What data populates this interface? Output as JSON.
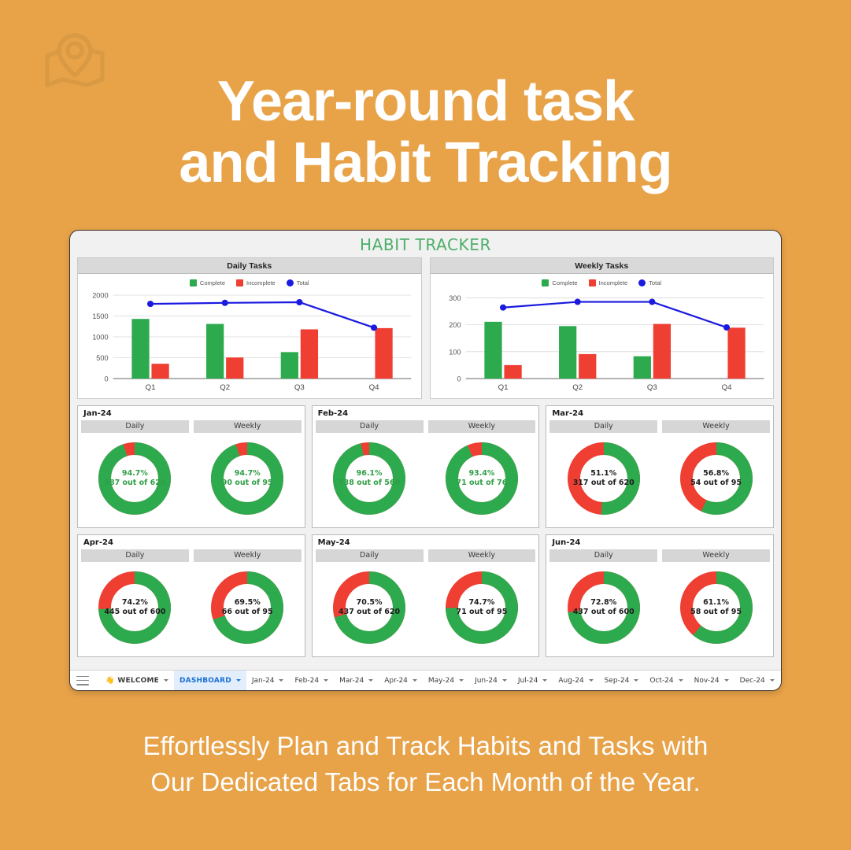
{
  "brand": {
    "logo_icon": "map-pin-icon",
    "bg_color": "#e8a349"
  },
  "headline": {
    "line1": "Year-round task",
    "line2": "and Habit Tracking"
  },
  "subtitle": {
    "line1": "Effortlessly Plan and Track Habits and Tasks with",
    "line2": "Our Dedicated Tabs for Each Month of the Year."
  },
  "window": {
    "title": "HABIT TRACKER",
    "title_color": "#4caf68"
  },
  "colors": {
    "complete_green": "#2eaa4e",
    "incomplete_red": "#ef3e32",
    "total_blue": "#1a1ae0",
    "header_gray": "#d9d9d9"
  },
  "legend": [
    {
      "label": "Complete",
      "swatch": "#2eaa4e",
      "shape": "square"
    },
    {
      "label": "Incomplete",
      "swatch": "#ef3e32",
      "shape": "square"
    },
    {
      "label": "Total",
      "swatch": "#1a1ae0",
      "shape": "dot"
    }
  ],
  "chart_data": [
    {
      "type": "bar",
      "title": "Daily Tasks",
      "categories": [
        "Q1",
        "Q2",
        "Q3",
        "Q4"
      ],
      "series": [
        {
          "name": "Complete",
          "type": "bar",
          "color": "#2eaa4e",
          "values": [
            1430,
            1310,
            635,
            0
          ]
        },
        {
          "name": "Incomplete",
          "type": "bar",
          "color": "#ef3e32",
          "values": [
            355,
            505,
            1180,
            1210
          ]
        },
        {
          "name": "Total",
          "type": "line",
          "color": "#1a1ae0",
          "values": [
            1790,
            1815,
            1830,
            1220
          ]
        }
      ],
      "xlabel": "",
      "ylabel": "",
      "ylim": [
        0,
        2000
      ],
      "yticks": [
        0,
        500,
        1000,
        1500,
        2000
      ],
      "grid": true,
      "legend_position": "top"
    },
    {
      "type": "bar",
      "title": "Weekly Tasks",
      "categories": [
        "Q1",
        "Q2",
        "Q3",
        "Q4"
      ],
      "series": [
        {
          "name": "Complete",
          "type": "bar",
          "color": "#2eaa4e",
          "values": [
            211,
            195,
            83,
            0
          ]
        },
        {
          "name": "Incomplete",
          "type": "bar",
          "color": "#ef3e32",
          "values": [
            50,
            91,
            203,
            189
          ]
        },
        {
          "name": "Total",
          "type": "line",
          "color": "#1a1ae0",
          "values": [
            264,
            285,
            285,
            190
          ]
        }
      ],
      "xlabel": "",
      "ylabel": "",
      "ylim": [
        0,
        310
      ],
      "yticks": [
        0,
        100,
        200,
        300
      ],
      "grid": true,
      "legend_position": "top"
    }
  ],
  "months": [
    {
      "label": "Jan-24",
      "panels": [
        {
          "head": "Daily",
          "percent": "94.7%",
          "count": "587 out of 620",
          "pct_value": 94.7,
          "text_color": "green"
        },
        {
          "head": "Weekly",
          "percent": "94.7%",
          "count": "90 out of 95",
          "pct_value": 94.7,
          "text_color": "green"
        }
      ]
    },
    {
      "label": "Feb-24",
      "panels": [
        {
          "head": "Daily",
          "percent": "96.1%",
          "count": "538 out of 560",
          "pct_value": 96.1,
          "text_color": "green"
        },
        {
          "head": "Weekly",
          "percent": "93.4%",
          "count": "71 out of 76",
          "pct_value": 93.4,
          "text_color": "green"
        }
      ]
    },
    {
      "label": "Mar-24",
      "panels": [
        {
          "head": "Daily",
          "percent": "51.1%",
          "count": "317 out of 620",
          "pct_value": 51.1,
          "text_color": "dark"
        },
        {
          "head": "Weekly",
          "percent": "56.8%",
          "count": "54 out of 95",
          "pct_value": 56.8,
          "text_color": "dark"
        }
      ]
    },
    {
      "label": "Apr-24",
      "panels": [
        {
          "head": "Daily",
          "percent": "74.2%",
          "count": "445 out of 600",
          "pct_value": 74.2,
          "text_color": "dark"
        },
        {
          "head": "Weekly",
          "percent": "69.5%",
          "count": "66 out of 95",
          "pct_value": 69.5,
          "text_color": "dark"
        }
      ]
    },
    {
      "label": "May-24",
      "panels": [
        {
          "head": "Daily",
          "percent": "70.5%",
          "count": "437 out of 620",
          "pct_value": 70.5,
          "text_color": "dark"
        },
        {
          "head": "Weekly",
          "percent": "74.7%",
          "count": "71 out of 95",
          "pct_value": 74.7,
          "text_color": "dark"
        }
      ]
    },
    {
      "label": "Jun-24",
      "panels": [
        {
          "head": "Daily",
          "percent": "72.8%",
          "count": "437 out of 600",
          "pct_value": 72.8,
          "text_color": "dark"
        },
        {
          "head": "Weekly",
          "percent": "61.1%",
          "count": "58 out of 95",
          "pct_value": 61.1,
          "text_color": "dark"
        }
      ]
    }
  ],
  "tabbar": {
    "menu_icon": "hamburger-icon",
    "tabs": [
      {
        "label": "WELCOME",
        "icon": "wave-icon",
        "active": false,
        "bold": true
      },
      {
        "label": "DASHBOARD",
        "icon": "",
        "active": true,
        "bold": true
      },
      {
        "label": "Jan-24",
        "icon": "",
        "active": false,
        "bold": false
      },
      {
        "label": "Feb-24",
        "icon": "",
        "active": false,
        "bold": false
      },
      {
        "label": "Mar-24",
        "icon": "",
        "active": false,
        "bold": false
      },
      {
        "label": "Apr-24",
        "icon": "",
        "active": false,
        "bold": false
      },
      {
        "label": "May-24",
        "icon": "",
        "active": false,
        "bold": false
      },
      {
        "label": "Jun-24",
        "icon": "",
        "active": false,
        "bold": false
      },
      {
        "label": "Jul-24",
        "icon": "",
        "active": false,
        "bold": false
      },
      {
        "label": "Aug-24",
        "icon": "",
        "active": false,
        "bold": false
      },
      {
        "label": "Sep-24",
        "icon": "",
        "active": false,
        "bold": false
      },
      {
        "label": "Oct-24",
        "icon": "",
        "active": false,
        "bold": false
      },
      {
        "label": "Nov-24",
        "icon": "",
        "active": false,
        "bold": false
      },
      {
        "label": "Dec-24",
        "icon": "",
        "active": false,
        "bold": false
      }
    ]
  }
}
